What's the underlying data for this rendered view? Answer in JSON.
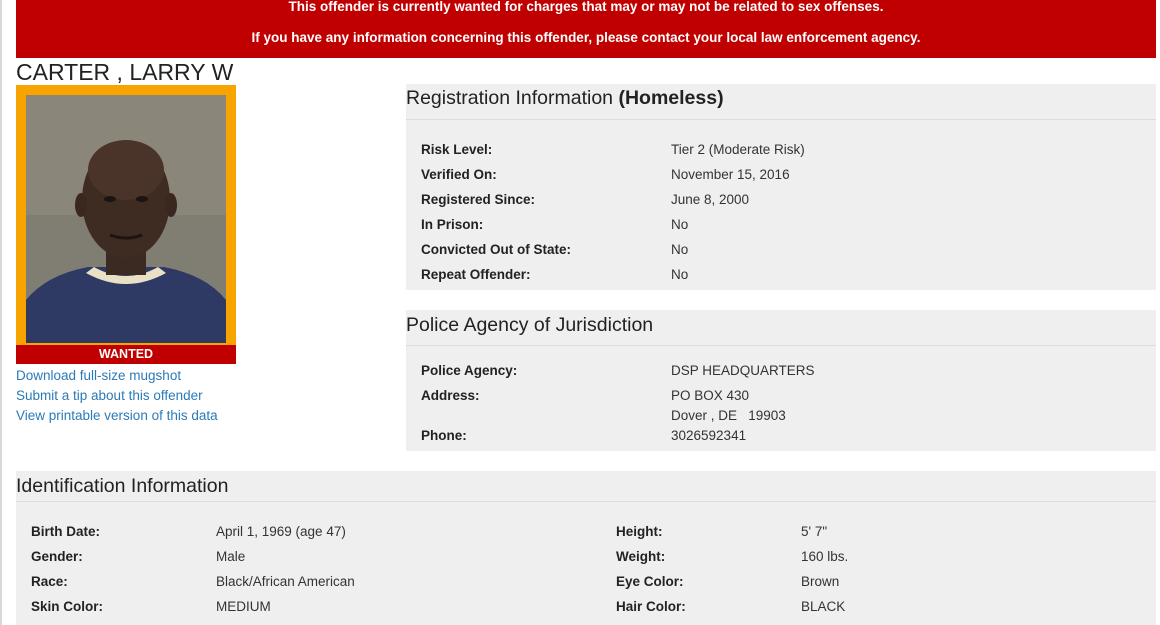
{
  "banner": {
    "line1": "This offender is currently wanted for charges that may or may not be related to sex offenses.",
    "line2": "If you have any information concerning this offender, please contact your local law enforcement agency."
  },
  "offender": {
    "name": "CARTER , LARRY W",
    "status_badge": "WANTED"
  },
  "links": {
    "download_mugshot": "Download full-size mugshot",
    "submit_tip": "Submit a tip about this offender",
    "printable": "View printable version of this data"
  },
  "registration": {
    "title": "Registration Information",
    "title_status": "(Homeless)",
    "fields": [
      {
        "label": "Risk Level:",
        "value": "Tier 2 (Moderate Risk)"
      },
      {
        "label": "Verified On:",
        "value": "November 15, 2016"
      },
      {
        "label": "Registered Since:",
        "value": "June 8, 2000"
      },
      {
        "label": "In Prison:",
        "value": "No"
      },
      {
        "label": "Convicted Out of State:",
        "value": "No"
      },
      {
        "label": "Repeat Offender:",
        "value": "No"
      }
    ]
  },
  "agency": {
    "title": "Police Agency of Jurisdiction",
    "police_agency_label": "Police Agency:",
    "police_agency_value": "DSP HEADQUARTERS",
    "address_label": "Address:",
    "address_line1": "PO BOX 430",
    "address_line2": "Dover , DE   19903",
    "phone_label": "Phone:",
    "phone_value": "3026592341"
  },
  "identification": {
    "title": "Identification Information",
    "left": [
      {
        "label": "Birth Date:",
        "value": "April 1, 1969 (age 47)"
      },
      {
        "label": "Gender:",
        "value": "Male"
      },
      {
        "label": "Race:",
        "value": "Black/African American"
      },
      {
        "label": "Skin Color:",
        "value": "MEDIUM"
      }
    ],
    "right": [
      {
        "label": "Height:",
        "value": "5' 7\""
      },
      {
        "label": "Weight:",
        "value": "160 lbs."
      },
      {
        "label": "Eye Color:",
        "value": "Brown"
      },
      {
        "label": "Hair Color:",
        "value": "BLACK"
      }
    ]
  },
  "colors": {
    "banner": "#c00000",
    "photo_frame": "#f7a300",
    "link": "#2a7ab8",
    "panel_bg": "#efefef"
  }
}
